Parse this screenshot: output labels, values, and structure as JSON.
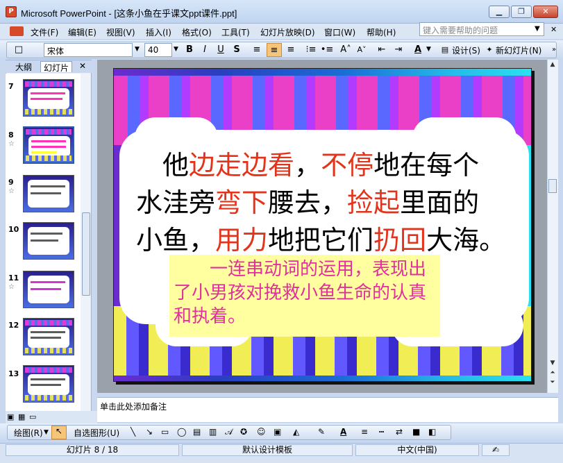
{
  "window": {
    "app_name": "Microsoft PowerPoint",
    "title": "Microsoft PowerPoint - [这条小鱼在乎课文ppt课件.ppt]",
    "app_icon_label": "P",
    "minimize_glyph": "▁",
    "restore_glyph": "❐",
    "close_glyph": "✕"
  },
  "menubar": {
    "items": [
      "文件(F)",
      "编辑(E)",
      "视图(V)",
      "插入(I)",
      "格式(O)",
      "工具(T)",
      "幻灯片放映(D)",
      "窗口(W)",
      "帮助(H)"
    ],
    "help_placeholder": "键入需要帮助的问题",
    "close_doc_glyph": "✕"
  },
  "toolbar": {
    "font_name": "宋体",
    "font_size": "40",
    "bold": "B",
    "italic": "I",
    "underline": "U",
    "shadow": "S",
    "design_label": "设计(S)",
    "new_slide_label": "新幻灯片(N)",
    "align_center_active": true
  },
  "left_pane": {
    "tabs": [
      "大纲",
      "幻灯片"
    ],
    "active_tab": "幻灯片",
    "close_glyph": "✕",
    "slides": [
      {
        "num": "7",
        "star": ""
      },
      {
        "num": "8",
        "star": "☆",
        "selected": true
      },
      {
        "num": "9",
        "star": "☆"
      },
      {
        "num": "10",
        "star": ""
      },
      {
        "num": "11",
        "star": "☆"
      },
      {
        "num": "12",
        "star": ""
      },
      {
        "num": "13",
        "star": ""
      }
    ]
  },
  "slide": {
    "line1_a": "他",
    "line1_b": "边走边看",
    "line1_c": "，",
    "line1_d": "不停",
    "line1_e": "地在每个",
    "line2_a": "水洼旁",
    "line2_b": "弯下",
    "line2_c": "腰去，",
    "line2_d": "捡起",
    "line2_e": "里面的",
    "line3_a": "小鱼，",
    "line3_b": "用力",
    "line3_c": "地把它们",
    "line3_d": "扔回",
    "line3_e": "大海。",
    "note": "一连串动词的运用，表现出了小男孩对挽救小鱼生命的认真和执着。",
    "highlight_color": "#e2331b",
    "note_color": "#e0309a",
    "note_bg": "#ffffa0"
  },
  "notes": {
    "placeholder": "单击此处添加备注"
  },
  "drawbar": {
    "draw_label": "绘图(R)",
    "autoshape_label": "自选图形(U)"
  },
  "status": {
    "slide_pos": "幻灯片 8 / 18",
    "template": "默认设计模板",
    "language": "中文(中国)"
  }
}
